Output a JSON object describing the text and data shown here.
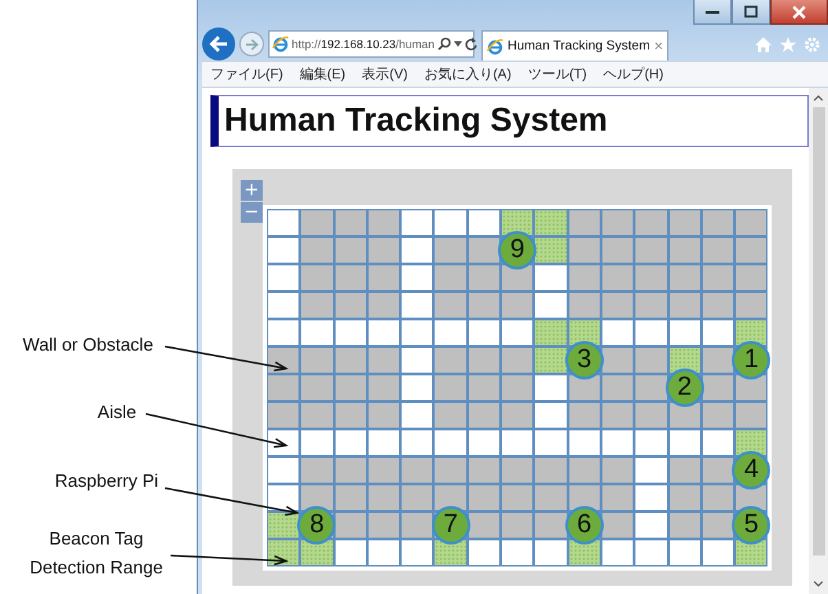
{
  "browser": {
    "address": {
      "scheme": "http://",
      "host": "192.168.10.23",
      "path": "/human"
    },
    "tab": {
      "title": "Human Tracking System",
      "close": "×"
    },
    "menu": [
      "ファイル(F)",
      "編集(E)",
      "表示(V)",
      "お気に入り(A)",
      "ツール(T)",
      "ヘルプ(H)"
    ]
  },
  "page": {
    "heading": "Human Tracking System",
    "map": {
      "zoom_in": "+",
      "zoom_out": "−",
      "rows": [
        {
          "cells": [
            {
              "kind": "aisle"
            },
            {
              "kind": "wall"
            },
            {
              "kind": "wall"
            },
            {
              "kind": "wall"
            },
            {
              "kind": "aisle"
            },
            {
              "kind": "aisle"
            },
            {
              "kind": "aisle"
            },
            {
              "kind": "range"
            },
            {
              "kind": "range"
            },
            {
              "kind": "wall"
            },
            {
              "kind": "wall"
            },
            {
              "kind": "wall"
            },
            {
              "kind": "wall"
            },
            {
              "kind": "wall"
            },
            {
              "kind": "wall"
            }
          ]
        },
        {
          "cells": [
            {
              "kind": "aisle"
            },
            {
              "kind": "wall"
            },
            {
              "kind": "wall"
            },
            {
              "kind": "wall"
            },
            {
              "kind": "aisle"
            },
            {
              "kind": "wall"
            },
            {
              "kind": "wall"
            },
            {
              "kind": "wall",
              "pi": "9"
            },
            {
              "kind": "range"
            },
            {
              "kind": "wall"
            },
            {
              "kind": "wall"
            },
            {
              "kind": "wall"
            },
            {
              "kind": "wall"
            },
            {
              "kind": "wall"
            },
            {
              "kind": "wall"
            }
          ]
        },
        {
          "cells": [
            {
              "kind": "aisle"
            },
            {
              "kind": "wall"
            },
            {
              "kind": "wall"
            },
            {
              "kind": "wall"
            },
            {
              "kind": "aisle"
            },
            {
              "kind": "wall"
            },
            {
              "kind": "wall"
            },
            {
              "kind": "wall"
            },
            {
              "kind": "aisle"
            },
            {
              "kind": "wall"
            },
            {
              "kind": "wall"
            },
            {
              "kind": "wall"
            },
            {
              "kind": "wall"
            },
            {
              "kind": "wall"
            },
            {
              "kind": "wall"
            }
          ]
        },
        {
          "cells": [
            {
              "kind": "aisle"
            },
            {
              "kind": "wall"
            },
            {
              "kind": "wall"
            },
            {
              "kind": "wall"
            },
            {
              "kind": "aisle"
            },
            {
              "kind": "wall"
            },
            {
              "kind": "wall"
            },
            {
              "kind": "wall"
            },
            {
              "kind": "aisle"
            },
            {
              "kind": "wall"
            },
            {
              "kind": "wall"
            },
            {
              "kind": "wall"
            },
            {
              "kind": "wall"
            },
            {
              "kind": "wall"
            },
            {
              "kind": "wall"
            }
          ]
        },
        {
          "cells": [
            {
              "kind": "aisle"
            },
            {
              "kind": "aisle"
            },
            {
              "kind": "aisle"
            },
            {
              "kind": "aisle"
            },
            {
              "kind": "aisle"
            },
            {
              "kind": "aisle"
            },
            {
              "kind": "aisle"
            },
            {
              "kind": "aisle"
            },
            {
              "kind": "range"
            },
            {
              "kind": "range"
            },
            {
              "kind": "aisle"
            },
            {
              "kind": "aisle"
            },
            {
              "kind": "aisle"
            },
            {
              "kind": "aisle"
            },
            {
              "kind": "range"
            }
          ]
        },
        {
          "cells": [
            {
              "kind": "wall"
            },
            {
              "kind": "wall"
            },
            {
              "kind": "wall"
            },
            {
              "kind": "wall"
            },
            {
              "kind": "aisle"
            },
            {
              "kind": "wall"
            },
            {
              "kind": "wall"
            },
            {
              "kind": "wall"
            },
            {
              "kind": "range"
            },
            {
              "kind": "wall",
              "pi": "3"
            },
            {
              "kind": "wall"
            },
            {
              "kind": "wall"
            },
            {
              "kind": "range"
            },
            {
              "kind": "wall"
            },
            {
              "kind": "wall",
              "pi": "1"
            }
          ]
        },
        {
          "cells": [
            {
              "kind": "wall"
            },
            {
              "kind": "wall"
            },
            {
              "kind": "wall"
            },
            {
              "kind": "wall"
            },
            {
              "kind": "aisle"
            },
            {
              "kind": "wall"
            },
            {
              "kind": "wall"
            },
            {
              "kind": "wall"
            },
            {
              "kind": "aisle"
            },
            {
              "kind": "wall"
            },
            {
              "kind": "wall"
            },
            {
              "kind": "wall"
            },
            {
              "kind": "wall",
              "pi": "2"
            },
            {
              "kind": "wall"
            },
            {
              "kind": "wall"
            }
          ]
        },
        {
          "cells": [
            {
              "kind": "wall"
            },
            {
              "kind": "wall"
            },
            {
              "kind": "wall"
            },
            {
              "kind": "wall"
            },
            {
              "kind": "aisle"
            },
            {
              "kind": "wall"
            },
            {
              "kind": "wall"
            },
            {
              "kind": "wall"
            },
            {
              "kind": "aisle"
            },
            {
              "kind": "wall"
            },
            {
              "kind": "wall"
            },
            {
              "kind": "wall"
            },
            {
              "kind": "wall"
            },
            {
              "kind": "wall"
            },
            {
              "kind": "wall"
            }
          ]
        },
        {
          "cells": [
            {
              "kind": "aisle"
            },
            {
              "kind": "aisle"
            },
            {
              "kind": "aisle"
            },
            {
              "kind": "aisle"
            },
            {
              "kind": "aisle"
            },
            {
              "kind": "aisle"
            },
            {
              "kind": "aisle"
            },
            {
              "kind": "aisle"
            },
            {
              "kind": "aisle"
            },
            {
              "kind": "aisle"
            },
            {
              "kind": "aisle"
            },
            {
              "kind": "aisle"
            },
            {
              "kind": "aisle"
            },
            {
              "kind": "aisle"
            },
            {
              "kind": "range"
            }
          ]
        },
        {
          "cells": [
            {
              "kind": "aisle"
            },
            {
              "kind": "wall"
            },
            {
              "kind": "wall"
            },
            {
              "kind": "wall"
            },
            {
              "kind": "wall"
            },
            {
              "kind": "wall"
            },
            {
              "kind": "wall"
            },
            {
              "kind": "wall"
            },
            {
              "kind": "wall"
            },
            {
              "kind": "wall"
            },
            {
              "kind": "wall"
            },
            {
              "kind": "aisle"
            },
            {
              "kind": "wall"
            },
            {
              "kind": "wall"
            },
            {
              "kind": "wall",
              "pi": "4"
            }
          ]
        },
        {
          "cells": [
            {
              "kind": "aisle"
            },
            {
              "kind": "wall"
            },
            {
              "kind": "wall"
            },
            {
              "kind": "wall"
            },
            {
              "kind": "wall"
            },
            {
              "kind": "wall"
            },
            {
              "kind": "wall"
            },
            {
              "kind": "wall"
            },
            {
              "kind": "wall"
            },
            {
              "kind": "wall"
            },
            {
              "kind": "wall"
            },
            {
              "kind": "aisle"
            },
            {
              "kind": "wall"
            },
            {
              "kind": "wall"
            },
            {
              "kind": "wall"
            }
          ]
        },
        {
          "cells": [
            {
              "kind": "range"
            },
            {
              "kind": "wall",
              "pi": "8"
            },
            {
              "kind": "wall"
            },
            {
              "kind": "wall"
            },
            {
              "kind": "wall"
            },
            {
              "kind": "wall",
              "pi": "7"
            },
            {
              "kind": "wall"
            },
            {
              "kind": "wall"
            },
            {
              "kind": "wall"
            },
            {
              "kind": "wall",
              "pi": "6"
            },
            {
              "kind": "wall"
            },
            {
              "kind": "aisle"
            },
            {
              "kind": "wall"
            },
            {
              "kind": "wall"
            },
            {
              "kind": "wall",
              "pi": "5"
            }
          ]
        },
        {
          "cells": [
            {
              "kind": "range"
            },
            {
              "kind": "range"
            },
            {
              "kind": "aisle"
            },
            {
              "kind": "aisle"
            },
            {
              "kind": "aisle"
            },
            {
              "kind": "range"
            },
            {
              "kind": "aisle"
            },
            {
              "kind": "aisle"
            },
            {
              "kind": "aisle"
            },
            {
              "kind": "range"
            },
            {
              "kind": "aisle"
            },
            {
              "kind": "aisle"
            },
            {
              "kind": "aisle"
            },
            {
              "kind": "aisle"
            },
            {
              "kind": "range"
            }
          ]
        }
      ]
    }
  },
  "annotations": [
    {
      "text": "Wall or Obstacle"
    },
    {
      "text": "Aisle"
    },
    {
      "text": "Raspberry Pi"
    },
    {
      "text": "Beacon Tag Detection Range"
    }
  ]
}
